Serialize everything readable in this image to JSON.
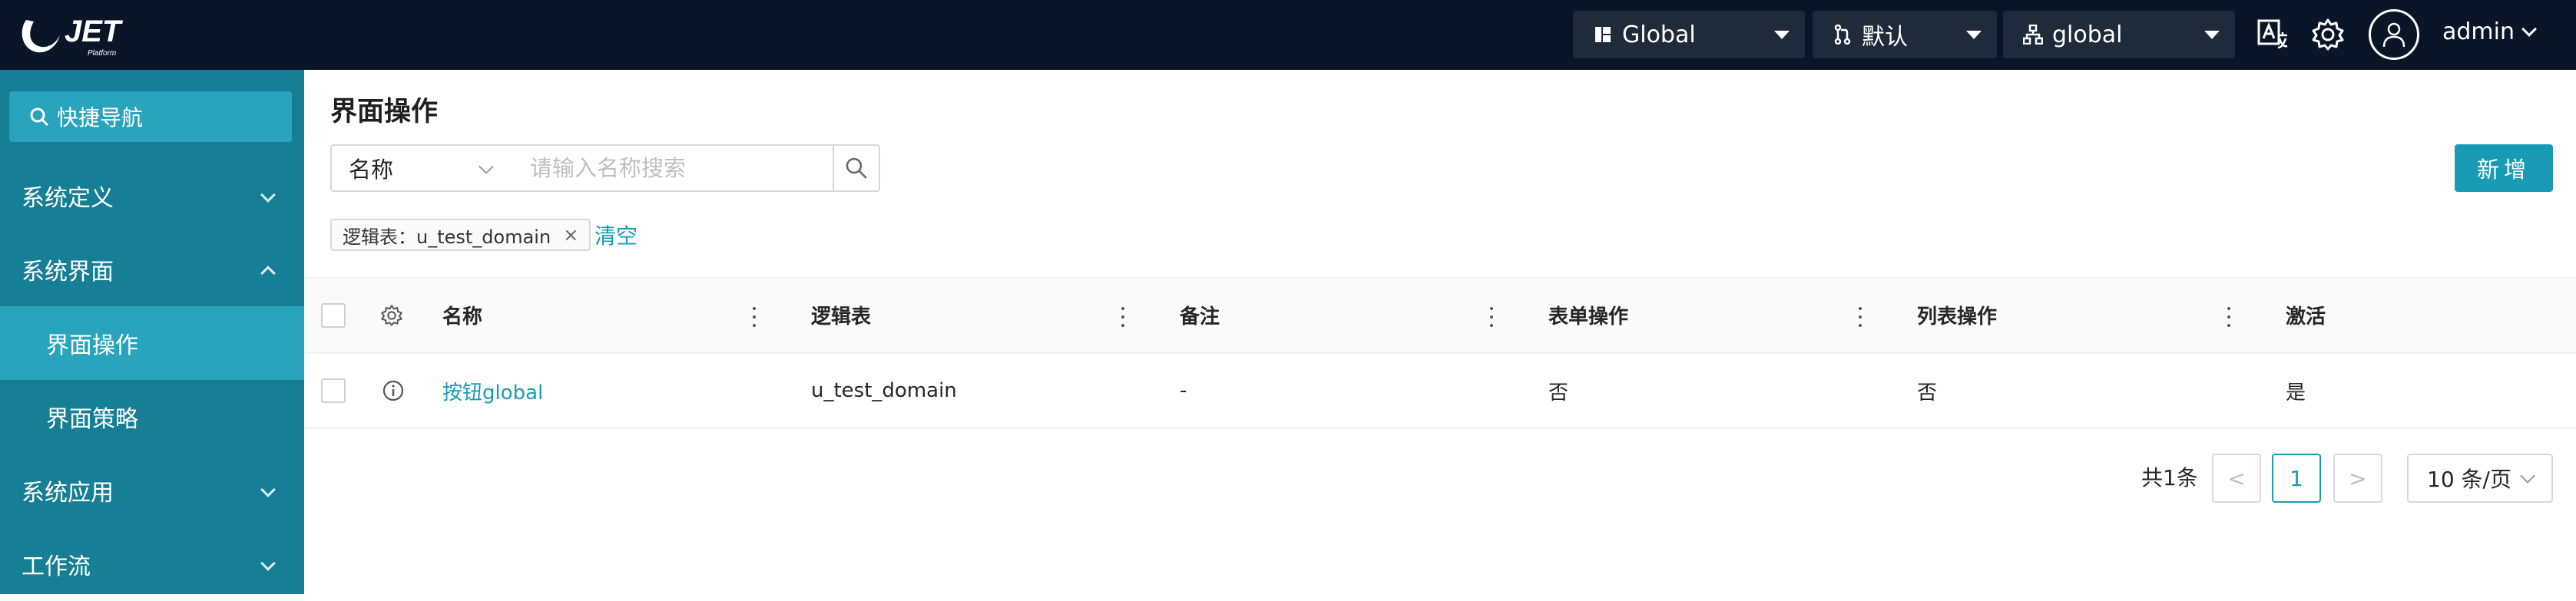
{
  "topbar": {
    "logo_text": "JET",
    "logo_sub": "Platform",
    "selects": [
      {
        "value": "Global",
        "icon": "layout-icon"
      },
      {
        "value": "默认",
        "icon": "branch-icon"
      },
      {
        "value": "global",
        "icon": "org-icon"
      }
    ],
    "icons": [
      "translate-icon",
      "gear-icon",
      "user-avatar-icon"
    ],
    "user": "admin"
  },
  "sidebar": {
    "quick_nav": "快捷导航",
    "items": [
      {
        "label": "系统定义",
        "expanded": false
      },
      {
        "label": "系统界面",
        "expanded": true
      },
      {
        "label": "界面操作",
        "sub": true,
        "active": true
      },
      {
        "label": "界面策略",
        "sub": true
      },
      {
        "label": "系统应用",
        "expanded": false
      },
      {
        "label": "工作流",
        "expanded": false
      }
    ]
  },
  "main": {
    "title": "界面操作",
    "search": {
      "field": "名称",
      "placeholder": "请输入名称搜索",
      "value": ""
    },
    "add_button": "新增",
    "filter_tag": "逻辑表：u_test_domain",
    "clear_label": "清空",
    "table": {
      "columns": [
        "名称",
        "逻辑表",
        "备注",
        "表单操作",
        "列表操作",
        "激活"
      ],
      "rows": [
        {
          "name": "按钮global",
          "table": "u_test_domain",
          "remark": "-",
          "form_op": "否",
          "list_op": "否",
          "active": "是"
        }
      ]
    },
    "pagination": {
      "total": "共1条",
      "current": "1",
      "prev": "<",
      "next": ">",
      "page_size": "10 条/页"
    }
  },
  "colors": {
    "topbar": "#0a1628",
    "sidebar": "#167f95",
    "accent": "#1a9bb5"
  }
}
